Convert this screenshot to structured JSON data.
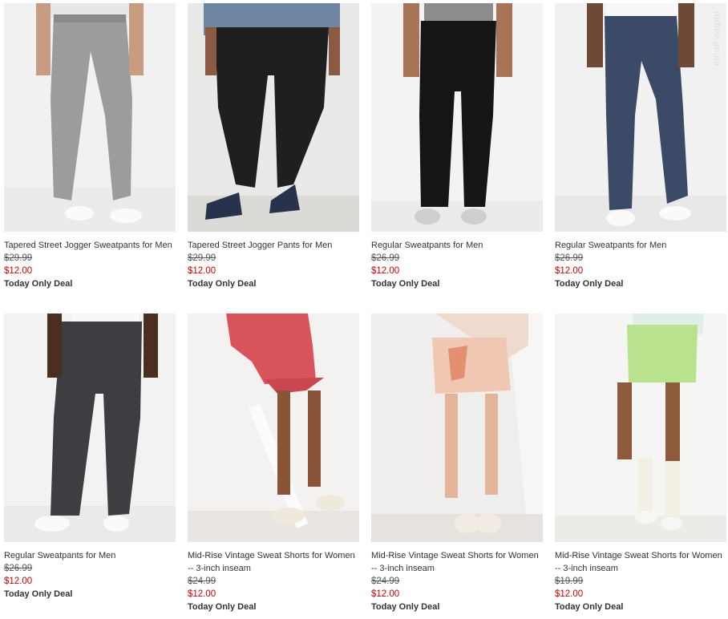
{
  "products": [
    {
      "title": "Tapered Street Jogger Sweatpants for Men",
      "original_price": "$29.99",
      "sale_price": "$12.00",
      "deal": "Today Only Deal",
      "image_alt": "men-gray-jogger-sweatpants"
    },
    {
      "title": "Tapered Street Jogger Pants for Men",
      "original_price": "$29.99",
      "sale_price": "$12.00",
      "deal": "Today Only Deal",
      "image_alt": "men-black-jogger-pants"
    },
    {
      "title": "Regular Sweatpants for Men",
      "original_price": "$26.99",
      "sale_price": "$12.00",
      "deal": "Today Only Deal",
      "image_alt": "men-black-sweatpants"
    },
    {
      "title": "Regular Sweatpants for Men",
      "original_price": "$26.99",
      "sale_price": "$12.00",
      "deal": "Today Only Deal",
      "image_alt": "men-navy-sweatpants"
    },
    {
      "title": "Regular Sweatpants for Men",
      "original_price": "$26.99",
      "sale_price": "$12.00",
      "deal": "Today Only Deal",
      "image_alt": "men-charcoal-sweatpants"
    },
    {
      "title": "Mid-Rise Vintage Sweat Shorts for Women -- 3-inch inseam",
      "original_price": "$24.99",
      "sale_price": "$12.00",
      "deal": "Today Only Deal",
      "image_alt": "women-red-print-shorts"
    },
    {
      "title": "Mid-Rise Vintage Sweat Shorts for Women -- 3-inch inseam",
      "original_price": "$24.99",
      "sale_price": "$12.00",
      "deal": "Today Only Deal",
      "image_alt": "women-tie-dye-shorts"
    },
    {
      "title": "Mid-Rise Vintage Sweat Shorts for Women -- 3-inch inseam",
      "original_price": "$19.99",
      "sale_price": "$12.00",
      "deal": "Today Only Deal",
      "image_alt": "women-lime-shorts"
    }
  ],
  "watermark": "ludiee.ge.ua",
  "colors": {
    "sale_red": "#cc0000",
    "text": "#333333"
  }
}
